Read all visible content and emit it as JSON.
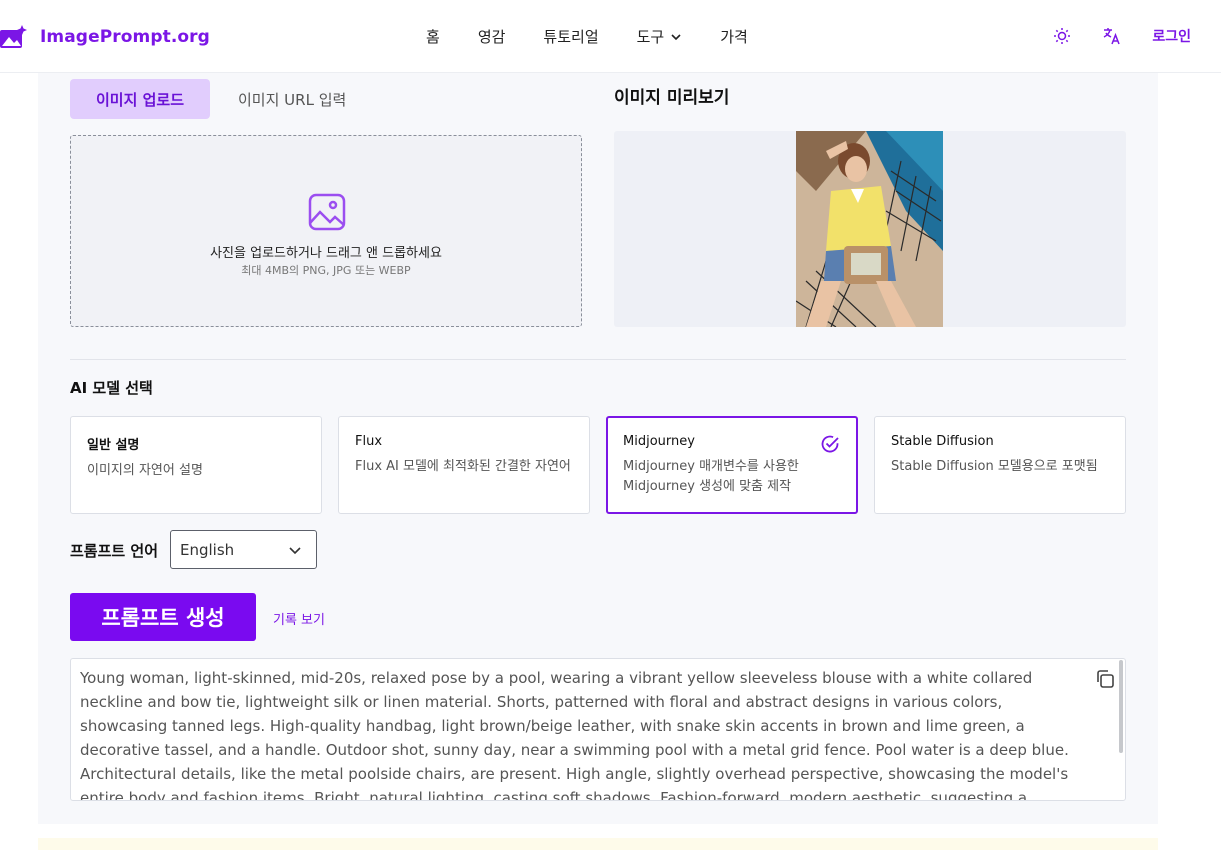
{
  "header": {
    "brand": "ImagePrompt.org",
    "nav": [
      "홈",
      "영감",
      "튜토리얼",
      "도구",
      "가격"
    ],
    "theme_icon": "sun-icon",
    "lang_icon": "translate-icon",
    "login": "로그인"
  },
  "upload": {
    "tab_upload": "이미지 업로드",
    "tab_url": "이미지 URL 입력",
    "dropzone_text": "사진을 업로드하거나 드래그 앤 드롭하세요",
    "dropzone_hint": "최대 4MB의 PNG, JPG 또는 WEBP",
    "preview_title": "이미지 미리보기"
  },
  "models": {
    "title": "AI 모델 선택",
    "cards": [
      {
        "title": "일반 설명",
        "desc": "이미지의 자연어 설명",
        "selected": false
      },
      {
        "title": "Flux",
        "desc": "Flux AI 모델에 최적화된 간결한 자연어",
        "selected": false
      },
      {
        "title": "Midjourney",
        "desc": "Midjourney 매개변수를 사용한 Midjourney 생성에 맞춤 제작",
        "selected": true
      },
      {
        "title": "Stable Diffusion",
        "desc": "Stable Diffusion 모델용으로 포맷됨",
        "selected": false
      }
    ]
  },
  "language": {
    "label": "프롬프트 언어",
    "value": "English"
  },
  "actions": {
    "generate": "프롬프트 생성",
    "history": "기록 보기"
  },
  "output": {
    "text": "Young woman, light-skinned, mid-20s, relaxed pose by a pool, wearing a vibrant yellow sleeveless blouse with a white collared neckline and bow tie,  lightweight silk or linen material.  Shorts, patterned with floral and abstract designs in various colors, showcasing tanned legs.  High-quality handbag, light brown/beige leather, with snake skin accents in brown and lime green,  a decorative tassel, and a handle.  Outdoor shot, sunny day, near a swimming pool with a metal grid fence.  Pool water is a deep blue.  Architectural details, like the metal poolside chairs, are present.  High angle, slightly overhead perspective, showcasing the model's entire body and fashion items.  Bright, natural lighting, casting soft shadows.  Fashion-forward, modern aesthetic, suggesting a luxury, summer-ready look.  Detailed"
  },
  "colors": {
    "accent": "#7b16e6",
    "button": "#7a0af0",
    "tab_bg": "#e1cdfd"
  }
}
